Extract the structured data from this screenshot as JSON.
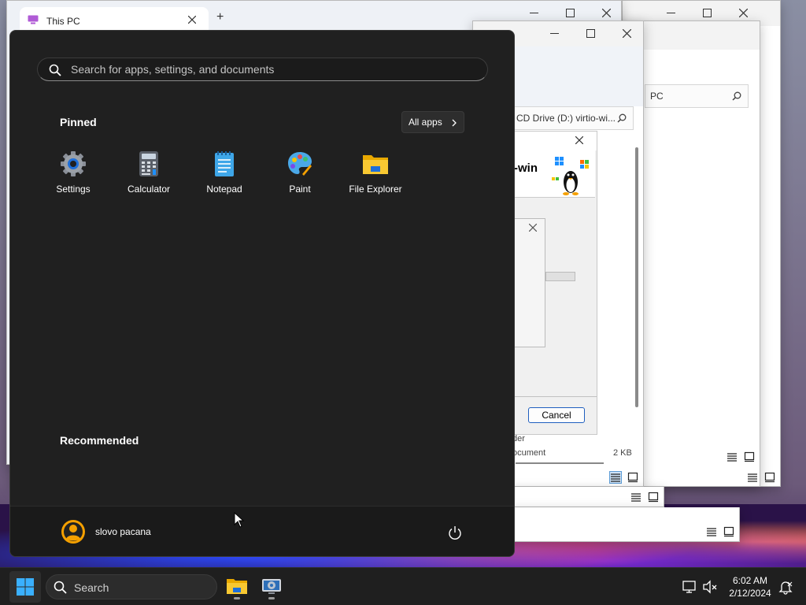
{
  "background_windows": {
    "browser_tab_title": "This PC",
    "new_tab_symbol": "+",
    "address_right": "PC",
    "address_middle": "CD Drive (D:) virtio-wi...",
    "setup_banner_text": "-win",
    "cancel_label": "Cancel",
    "list_text_1": "der",
    "list_text_2": "ocument",
    "list_size": "2 KB"
  },
  "start_menu": {
    "search_placeholder": "Search for apps, settings, and documents",
    "pinned_title": "Pinned",
    "all_apps_label": "All apps",
    "pinned_apps": [
      {
        "label": "Settings",
        "icon": "settings-icon"
      },
      {
        "label": "Calculator",
        "icon": "calculator-icon"
      },
      {
        "label": "Notepad",
        "icon": "notepad-icon"
      },
      {
        "label": "Paint",
        "icon": "paint-icon"
      },
      {
        "label": "File Explorer",
        "icon": "file-explorer-icon"
      }
    ],
    "recommended_title": "Recommended",
    "user_name": "slovo pacana"
  },
  "taskbar": {
    "search_label": "Search",
    "time": "6:02 AM",
    "date": "2/12/2024"
  },
  "colors": {
    "start_bg": "#202020",
    "taskbar_bg": "#1f1f1f",
    "accent_blue": "#0078d4",
    "folder_yellow": "#f4c430"
  }
}
